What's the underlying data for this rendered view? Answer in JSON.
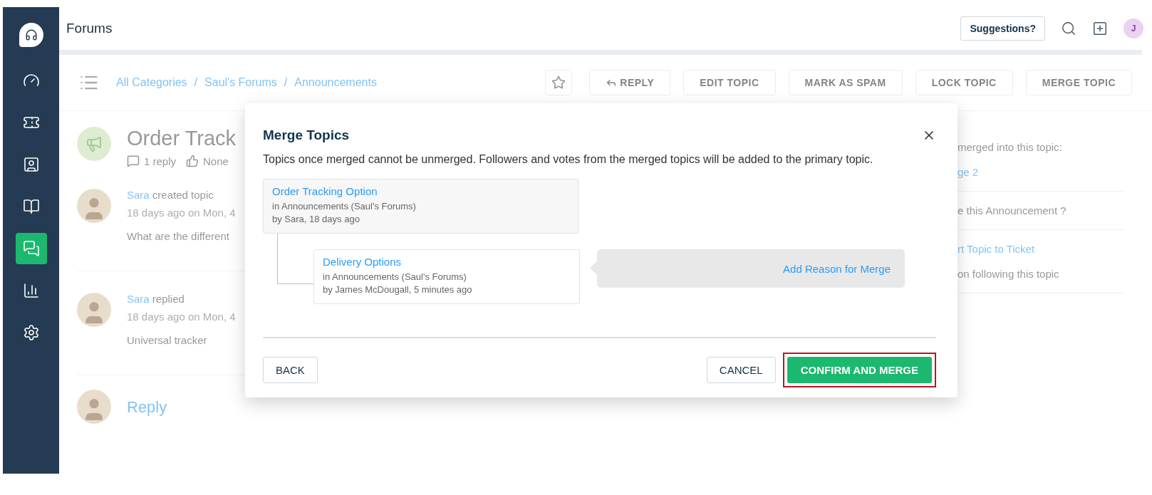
{
  "top_bar": {
    "title": "Forums",
    "suggestions_button": "Suggestions?",
    "avatar_initial": "J"
  },
  "sidebar": {
    "items": [
      {
        "kind": "gauge",
        "selected": false
      },
      {
        "kind": "ticket",
        "selected": false
      },
      {
        "kind": "contact",
        "selected": false
      },
      {
        "kind": "book",
        "selected": false
      },
      {
        "kind": "chat",
        "selected": true
      },
      {
        "kind": "chart",
        "selected": false
      },
      {
        "kind": "gear",
        "selected": false
      }
    ]
  },
  "breadcrumb": {
    "separator": "/",
    "items": [
      "All Categories",
      "Saul's Forums",
      "Announcements"
    ]
  },
  "toolbar": {
    "starred": false,
    "buttons": [
      {
        "label": "REPLY",
        "kind": "reply"
      },
      {
        "label": "EDIT TOPIC",
        "kind": "plain"
      },
      {
        "label": "MARK AS SPAM",
        "kind": "plain"
      },
      {
        "label": "LOCK TOPIC",
        "kind": "plain"
      },
      {
        "label": "MERGE TOPIC",
        "kind": "plain"
      }
    ]
  },
  "topic": {
    "title": "Order Track",
    "reply_count": "1 reply",
    "votes": "None"
  },
  "posts": [
    {
      "author": "Sara",
      "action": "created topic",
      "time": "18 days ago on Mon, 4",
      "body": "What are the different"
    },
    {
      "author": "Sara",
      "action": "replied",
      "time": "18 days ago on Mon, 4",
      "body": "Universal tracker"
    }
  ],
  "reply_prompt": "Reply",
  "side_panel": [
    {
      "lines": [
        {
          "text": "merged into this topic:",
          "kind": "text"
        },
        {
          "text": "ge 2",
          "kind": "link"
        }
      ]
    },
    {
      "lines": [
        {
          "text": "e this Announcement ?",
          "kind": "text"
        }
      ]
    },
    {
      "lines": [
        {
          "text": "rt Topic to Ticket",
          "kind": "link"
        },
        {
          "text": "on following this topic",
          "kind": "text"
        }
      ]
    }
  ],
  "modal": {
    "title": "Merge Topics",
    "description": "Topics once merged cannot be unmerged. Followers and votes from the merged topics will be added to the primary topic.",
    "primary_topic": {
      "title": "Order Tracking Option",
      "category": "in Announcements (Saul's Forums)",
      "byline": "by Sara, 18 days ago"
    },
    "merged_topics": [
      {
        "title": "Delivery Options",
        "category": "in Announcements (Saul's Forums)",
        "byline": "by James McDougall, 5 minutes ago",
        "reason_link": "Add Reason for Merge"
      }
    ],
    "back_button": "BACK",
    "cancel_button": "CANCEL",
    "confirm_button": {
      "label": "CONFIRM AND MERGE",
      "highlighted": true
    }
  }
}
